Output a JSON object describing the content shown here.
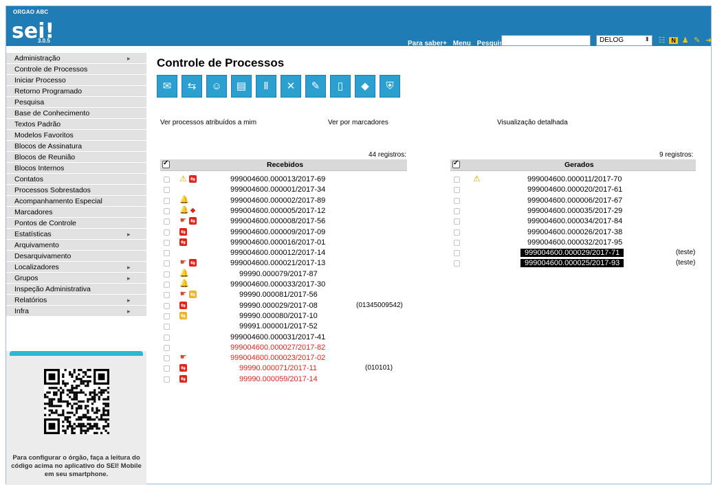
{
  "header": {
    "org": "ORGAO ABC",
    "logo": "sei!",
    "version": "3.0.5",
    "links": [
      "Para saber+",
      "Menu",
      "Pesquisa"
    ],
    "search_value": "",
    "unit": "DELOG",
    "icons": [
      "grid-icon",
      "notes-icon",
      "user-icon",
      "tools-icon",
      "exit-icon"
    ]
  },
  "sidebar": {
    "items": [
      {
        "label": "Administração",
        "submenu": true
      },
      {
        "label": "Controle de Processos",
        "submenu": false
      },
      {
        "label": "Iniciar Processo",
        "submenu": false
      },
      {
        "label": "Retorno Programado",
        "submenu": false
      },
      {
        "label": "Pesquisa",
        "submenu": false
      },
      {
        "label": "Base de Conhecimento",
        "submenu": false
      },
      {
        "label": "Textos Padrão",
        "submenu": false
      },
      {
        "label": "Modelos Favoritos",
        "submenu": false
      },
      {
        "label": "Blocos de Assinatura",
        "submenu": false
      },
      {
        "label": "Blocos de Reunião",
        "submenu": false
      },
      {
        "label": "Blocos Internos",
        "submenu": false
      },
      {
        "label": "Contatos",
        "submenu": false
      },
      {
        "label": "Processos Sobrestados",
        "submenu": false
      },
      {
        "label": "Acompanhamento Especial",
        "submenu": false
      },
      {
        "label": "Marcadores",
        "submenu": false
      },
      {
        "label": "Pontos de Controle",
        "submenu": false
      },
      {
        "label": "Estatísticas",
        "submenu": true
      },
      {
        "label": "Arquivamento",
        "submenu": false
      },
      {
        "label": "Desarquivamento",
        "submenu": false
      },
      {
        "label": "Localizadores",
        "submenu": true
      },
      {
        "label": "Grupos",
        "submenu": true
      },
      {
        "label": "Inspeção Administrativa",
        "submenu": false
      },
      {
        "label": "Relatórios",
        "submenu": true
      },
      {
        "label": "Infra",
        "submenu": true
      }
    ],
    "qr_text": "Para configurar o órgão, faça a leitura do código acima no aplicativo do SEI! Mobile em seu smartphone."
  },
  "main": {
    "title": "Controle de Processos",
    "toolbar": [
      "send-icon",
      "workflow-icon",
      "assign-icon",
      "documents-icon",
      "suspend-icon",
      "conclude-icon",
      "note-icon",
      "new-document-icon",
      "tag-icon",
      "shield-icon"
    ],
    "links": [
      "Ver processos atribuídos a mim",
      "Ver por marcadores",
      "Visualização detalhada"
    ]
  },
  "recebidos": {
    "title": "Recebidos",
    "count": "44 registros:",
    "rows": [
      {
        "num": "999004600.000013/2017-69",
        "icons": [
          "warn",
          "arrows"
        ],
        "red": false
      },
      {
        "num": "999004600.000001/2017-34",
        "icons": [],
        "red": false
      },
      {
        "num": "999004600.000002/2017-89",
        "icons": [
          "bell"
        ],
        "red": false
      },
      {
        "num": "999004600.000005/2017-12",
        "icons": [
          "bell",
          "tag"
        ],
        "red": false
      },
      {
        "num": "999004600.000008/2017-56",
        "icons": [
          "hand",
          "arrows"
        ],
        "red": false
      },
      {
        "num": "999004600.000009/2017-09",
        "icons": [
          "arrows"
        ],
        "red": false
      },
      {
        "num": "999004600.000016/2017-01",
        "icons": [
          "arrows"
        ],
        "red": false
      },
      {
        "num": "999004600.000012/2017-14",
        "icons": [],
        "red": false
      },
      {
        "num": "999004600.000021/2017-13",
        "icons": [
          "hand",
          "arrows"
        ],
        "red": false
      },
      {
        "num": "99990.000079/2017-87",
        "icons": [
          "bell"
        ],
        "red": false
      },
      {
        "num": "999004600.000033/2017-30",
        "icons": [
          "bell"
        ],
        "red": false
      },
      {
        "num": "99990.000081/2017-56",
        "icons": [
          "hand",
          "arrows-yellow"
        ],
        "red": false
      },
      {
        "num": "99990.000029/2017-08",
        "icons": [
          "arrows"
        ],
        "red": false,
        "note": "(01345009542)"
      },
      {
        "num": "99990.000080/2017-10",
        "icons": [
          "arrows-yellow"
        ],
        "red": false
      },
      {
        "num": "99991.000001/2017-52",
        "icons": [],
        "red": false
      },
      {
        "num": "999004600.000031/2017-41",
        "icons": [],
        "red": false
      },
      {
        "num": "999004600.000027/2017-82",
        "icons": [],
        "red": true
      },
      {
        "num": "999004600.000023/2017-02",
        "icons": [
          "hand"
        ],
        "red": true
      },
      {
        "num": "99990.000071/2017-11",
        "icons": [
          "arrows"
        ],
        "red": true,
        "note": "(010101)"
      },
      {
        "num": "99990.000059/2017-14",
        "icons": [
          "arrows"
        ],
        "red": true
      }
    ]
  },
  "gerados": {
    "title": "Gerados",
    "count": "9 registros:",
    "rows": [
      {
        "num": "999004600.000011/2017-70",
        "icons": [
          "warn"
        ],
        "highlight": false
      },
      {
        "num": "999004600.000020/2017-61",
        "icons": [],
        "highlight": false
      },
      {
        "num": "999004600.000006/2017-67",
        "icons": [],
        "highlight": false
      },
      {
        "num": "999004600.000035/2017-29",
        "icons": [],
        "highlight": false
      },
      {
        "num": "999004600.000034/2017-84",
        "icons": [],
        "highlight": false
      },
      {
        "num": "999004600.000026/2017-38",
        "icons": [],
        "highlight": false
      },
      {
        "num": "999004600.000032/2017-95",
        "icons": [],
        "highlight": false
      },
      {
        "num": "999004600.000029/2017-71",
        "icons": [],
        "highlight": true,
        "note": "(teste)"
      },
      {
        "num": "999004600.000025/2017-93",
        "icons": [],
        "highlight": true,
        "note": "(teste)"
      }
    ]
  }
}
